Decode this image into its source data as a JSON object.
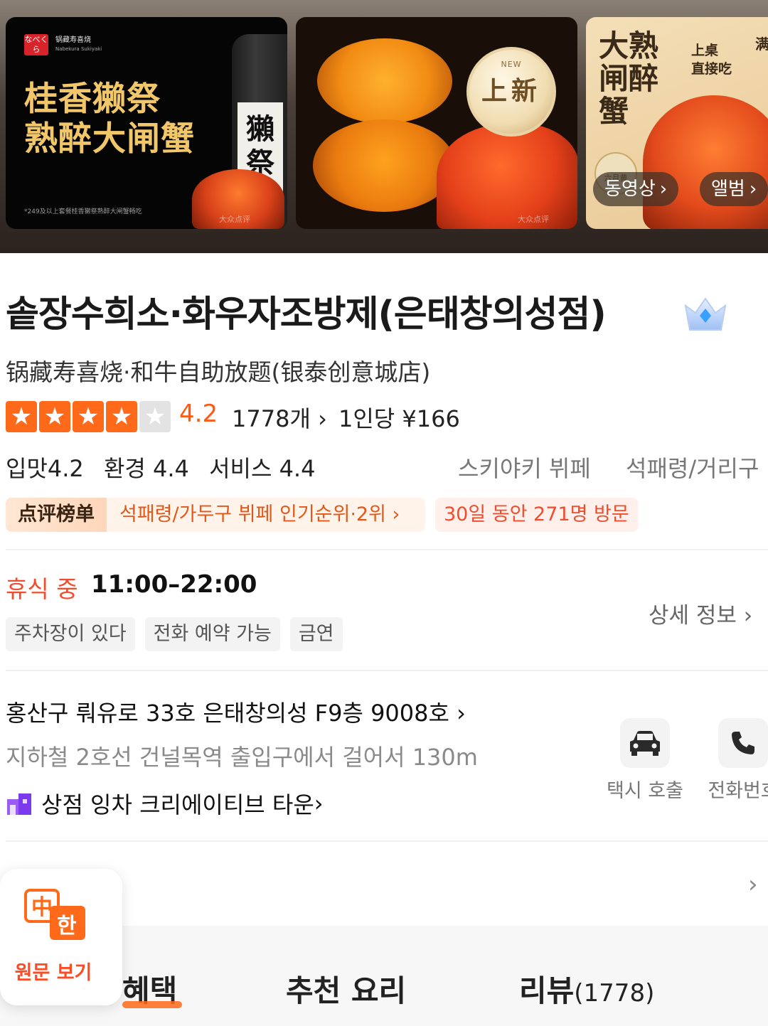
{
  "banners": {
    "card1": {
      "logo_text": "なべくら",
      "brand": "锅藏寿喜烧",
      "brand_en": "Nabekura Sukiyaki",
      "headline_line1": "桂香獭祭",
      "headline_line2": "熟醉大闸蟹",
      "footnote": "*249及以上套餐桂香獭祭熟醉大闸蟹畅吃",
      "bottle_label": "獺祭",
      "watermark": "大众点评"
    },
    "card2": {
      "badge_small": "NEW",
      "badge_text": "上新",
      "watermark": "大众点评"
    },
    "card3": {
      "title": "大熟闸醉蟹",
      "side_line1": "上桌",
      "side_line2": "直接吃",
      "top_right": "满",
      "seal_text": "六月黄"
    },
    "video_pill": "동영상",
    "album_pill": "앨범"
  },
  "store": {
    "title": "솥장수희소·화우자조방제(은태창의성점)",
    "original_name": "锅藏寿喜烧·和牛自助放题(银泰创意城店)",
    "rating": {
      "stars": 4.5,
      "score": "4.2",
      "review_count": "1778개",
      "per_person": "1인당 ¥166"
    },
    "sub_scores": {
      "taste": "입맛4.2",
      "environment": "환경 4.4",
      "service": "서비스 4.4"
    },
    "category": "스키야키 뷔페",
    "district": "석패령/거리구"
  },
  "ranking": {
    "tag": "点评榜单",
    "text": "석패령/가두구 뷔페 인기순위·2위",
    "visits": "30일 동안 271명 방문"
  },
  "hours": {
    "status": "휴식 중",
    "time": "11:00–22:00",
    "detail_link": "상세 정보",
    "tags": [
      "주차장이 있다",
      "전화 예약 가능",
      "금연"
    ]
  },
  "location": {
    "address": "홍산구 뤄유로 33호 은태창의성 F9층 9008호",
    "subway": "지하철 2호선 건널목역 출입구에서 걸어서 130m",
    "mall": "상점 잉차 크리에이티브 타운",
    "actions": {
      "taxi": "택시 호출",
      "phone": "전화번호"
    }
  },
  "translate": {
    "icon_zh": "中",
    "icon_ko": "한",
    "label": "원문 보기"
  },
  "tabs": {
    "benefits": "혜택",
    "dishes": "추천 요리",
    "reviews": "리뷰",
    "reviews_count": "(1778)"
  },
  "colors": {
    "accent_orange": "#ff6a1a",
    "status_red": "#ef4d2d"
  }
}
